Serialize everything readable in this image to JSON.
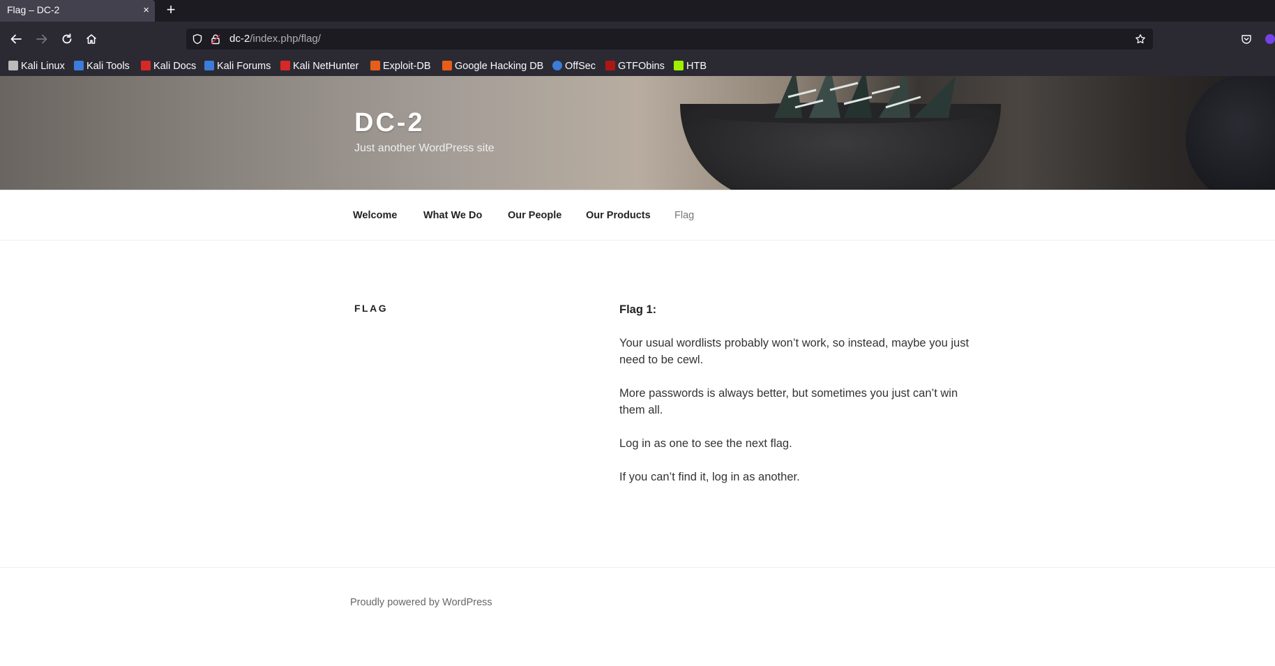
{
  "browser": {
    "tab_title": "Flag – DC-2",
    "tab_close": "×",
    "new_tab": "+",
    "url_host": "dc-2",
    "url_path": "/index.php/flag/",
    "bookmarks": [
      {
        "label": "Kali Linux",
        "icon": "kali-dragon-icon",
        "color": "#bbbbbb"
      },
      {
        "label": "Kali Tools",
        "icon": "kali-tools-icon",
        "color": "#3b7dd8"
      },
      {
        "label": "Kali Docs",
        "icon": "kali-docs-icon",
        "color": "#d62828"
      },
      {
        "label": "Kali Forums",
        "icon": "kali-forums-icon",
        "color": "#3b7dd8"
      },
      {
        "label": "Kali NetHunter",
        "icon": "nethunter-icon",
        "color": "#d62828"
      },
      {
        "label": "Exploit-DB",
        "icon": "exploit-db-icon",
        "color": "#e85d1a"
      },
      {
        "label": "Google Hacking DB",
        "icon": "ghdb-icon",
        "color": "#e85d1a"
      },
      {
        "label": "OffSec",
        "icon": "offsec-icon",
        "color": "#3b7dd8"
      },
      {
        "label": "GTFObins",
        "icon": "gtfobins-icon",
        "color": "#b01515"
      },
      {
        "label": "HTB",
        "icon": "htb-icon",
        "color": "#9fef00"
      }
    ]
  },
  "site": {
    "title": "DC-2",
    "description": "Just another WordPress site",
    "menu": [
      {
        "label": "Welcome",
        "current": false
      },
      {
        "label": "What We Do",
        "current": false
      },
      {
        "label": "Our People",
        "current": false
      },
      {
        "label": "Our Products",
        "current": false
      },
      {
        "label": "Flag",
        "current": true
      }
    ]
  },
  "page": {
    "title": "FLAG",
    "heading": "Flag 1:",
    "paragraphs": [
      "Your usual wordlists probably won’t work, so instead, maybe you just need to be cewl.",
      "More passwords is always better, but sometimes you just can’t win them all.",
      "Log in as one to see the next flag.",
      "If you can’t find it, log in as another."
    ]
  },
  "footer": {
    "credit": "Proudly powered by WordPress"
  }
}
